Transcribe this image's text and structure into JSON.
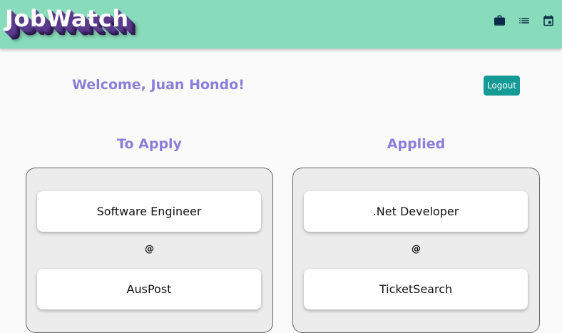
{
  "app": {
    "title": "JobWatch"
  },
  "nav": {
    "icons": [
      "briefcase-icon",
      "list-icon",
      "calendar-icon"
    ],
    "icon_color": "#0e2a4a"
  },
  "header": {
    "welcome": "Welcome, Juan Hondo!",
    "logout_label": "Logout"
  },
  "columns": [
    {
      "title": "To Apply",
      "job": "Software Engineer",
      "at": "@",
      "company": "AusPost"
    },
    {
      "title": "Applied",
      "job": ".Net Developer",
      "at": "@",
      "company": "TicketSearch"
    }
  ],
  "colors": {
    "topbar": "#89dcbb",
    "accent_text": "#8b7ed8",
    "logout_button": "#159a96",
    "panel": "#ececec"
  }
}
